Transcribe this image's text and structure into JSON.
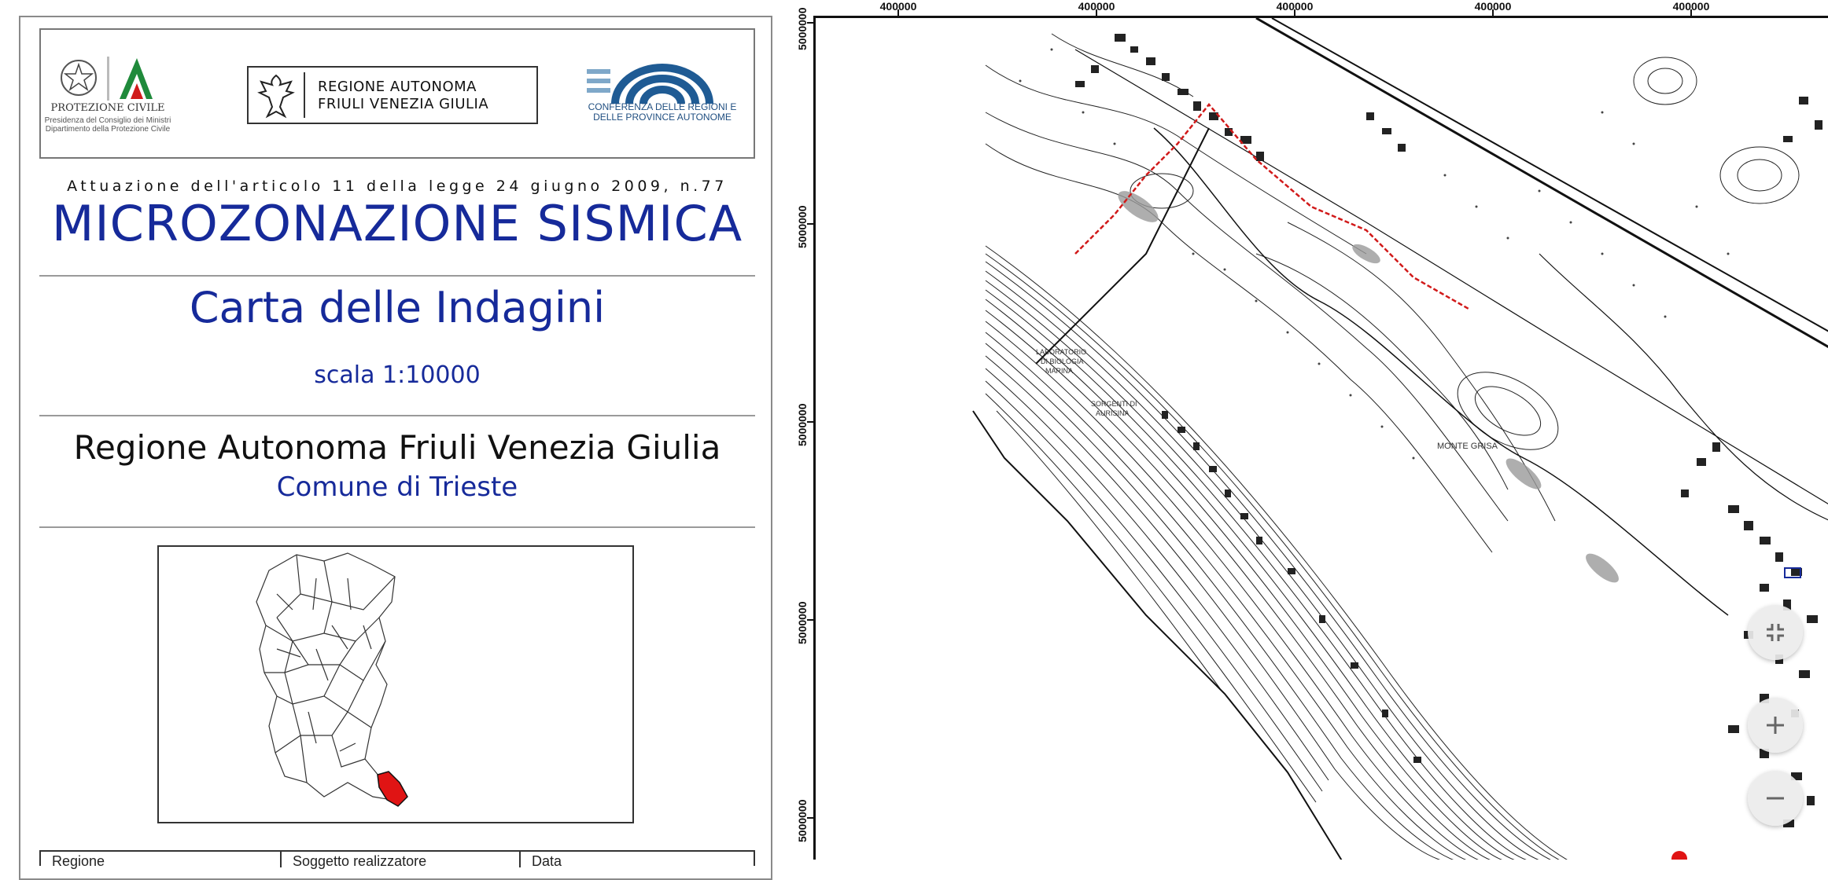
{
  "document": {
    "logos": {
      "protezione_civile": {
        "title": "PROTEZIONE CIVILE",
        "subtitle_line1": "Presidenza del Consiglio dei Ministri",
        "subtitle_line2": "Dipartimento della Protezione Civile"
      },
      "regione": {
        "line1": "REGIONE AUTONOMA",
        "line2": "FRIULI VENEZIA GIULIA"
      },
      "conferenza": {
        "line1": "CONFERENZA DELLE REGIONI E",
        "line2": "DELLE PROVINCE AUTONOME"
      }
    },
    "law_reference": "Attuazione dell'articolo 11 della legge 24 giugno 2009, n.77",
    "title": "MICROZONAZIONE SISMICA",
    "subtitle": "Carta delle Indagini",
    "scale": "scala 1:10000",
    "region": "Regione Autonoma Friuli Venezia Giulia",
    "comune": "Comune di Trieste",
    "info_table": {
      "col1": "Regione",
      "col2": "Soggetto realizzatore",
      "col3": "Data"
    }
  },
  "map": {
    "x_ticks": [
      "400000",
      "400000",
      "400000",
      "400000",
      "400000"
    ],
    "y_ticks": [
      "5000000",
      "5000000",
      "5000000",
      "5000000",
      "5000000"
    ],
    "labels": {
      "lab1": "LABORATORIO",
      "lab2": "DI BIOLOGIA",
      "lab3": "MARINA",
      "sorgenti1": "SORGENTI DI",
      "sorgenti2": "AURISINA",
      "monte": "MONTE GRISA"
    },
    "colors": {
      "boundary": "#d11a1a",
      "highlight": "#e01414",
      "title_blue": "#162a9a"
    }
  },
  "controls": {
    "exit_fullscreen_icon": "collapse-icon",
    "zoom_in_icon": "plus-icon",
    "zoom_out_icon": "minus-icon"
  }
}
